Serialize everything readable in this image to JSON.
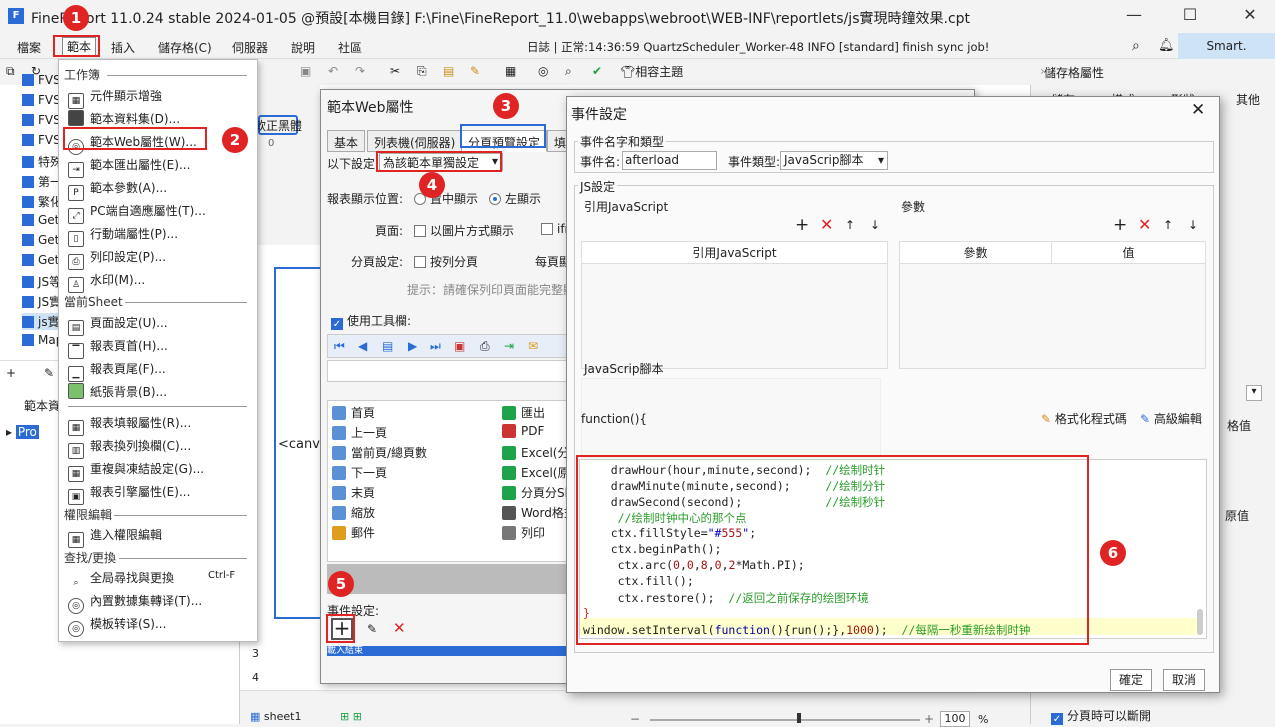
{
  "window": {
    "title": "FineReport 11.0.24 stable 2024-01-05 @預設[本機目錄]    F:\\Fine\\FineReport_11.0\\webapps\\webroot\\WEB-INF\\reportlets/js實現時鐘效果.cpt",
    "minimize": "—",
    "maximize": "☐",
    "close": "✕"
  },
  "menubar": {
    "items": [
      "檔案",
      "範本",
      "插入",
      "儲存格(C)",
      "伺服器",
      "說明",
      "社區"
    ],
    "log": "日誌 | 正常:14:36:59 QuartzScheduler_Worker-48 INFO [standard] finish sync job!",
    "user": "Smart."
  },
  "toolbar": {
    "compat_theme": "相容主題"
  },
  "leftpanel": {
    "tree": [
      "FVS",
      "FVS",
      "FVS",
      "FVS",
      "特殊",
      "第一",
      "繁化",
      "Get",
      "Get",
      "Get",
      "JS等",
      "JS實",
      "js實",
      "Map"
    ],
    "template_label": "範本資",
    "project": "Pro"
  },
  "dropdown": {
    "sections": {
      "workbook": "工作簿",
      "current_sheet": "當前Sheet",
      "permission": "權限編輯",
      "find": "查找/更換"
    },
    "workbook_items": [
      "元件顯示增強",
      "範本資料集(D)...",
      "範本Web屬性(W)...",
      "範本匯出屬性(E)...",
      "範本參數(A)...",
      "PC端自適應屬性(T)...",
      "行動端屬性(P)...",
      "列印設定(P)...",
      "水印(M)..."
    ],
    "sheet_items": [
      "頁面設定(U)...",
      "報表頁首(H)...",
      "報表頁尾(F)...",
      "紙張背景(B)...",
      "報表填報屬性(R)...",
      "報表換列換欄(C)...",
      "重複與凍結設定(G)...",
      "報表引擎屬性(E)..."
    ],
    "permission_items": [
      "進入權限編輯"
    ],
    "find_items": [
      "全局尋找與更換",
      "內置數據集轉译(T)...",
      "模板转译(S)..."
    ],
    "find_shortcut": "Ctrl-F"
  },
  "sheet": {
    "font_label": "軟正黑體",
    "canvas_text": "<canv",
    "row3": "3",
    "row4": "4",
    "sheet_tab": "sheet1",
    "zoom": "100",
    "zoom_unit": "%"
  },
  "webdlg": {
    "title": "範本Web屬性",
    "tabs": [
      "基本",
      "列表機(伺服器)",
      "分頁預覽設定",
      "填"
    ],
    "setting_label": "以下設定",
    "setting_value": "為該範本單獨設定",
    "display_pos_label": "報表顯示位置:",
    "center": "置中顯示",
    "left": "左顯示",
    "page_label": "頁面:",
    "image_mode": "以圖片方式顯示",
    "ifr": "ifr",
    "paging_label": "分頁設定:",
    "by_column": "按列分頁",
    "per_page": "每頁顯",
    "hint": "提示：請確保列印頁面能完整顯",
    "use_toolbar": "使用工具欄:",
    "buttons_left": [
      "首頁",
      "上一頁",
      "當前頁/總頁數",
      "下一頁",
      "末頁",
      "縮放",
      "郵件"
    ],
    "buttons_right": [
      "匯出",
      "PDF",
      "Excel(分頁",
      "Excel(原樣",
      "分頁分Sh",
      "Word格式",
      "列印"
    ],
    "event_label": "事件設定:",
    "event_row": "載入結束"
  },
  "evtdlg": {
    "title": "事件設定",
    "name_type_group": "事件名字和類型",
    "name_label": "事件名:",
    "name_value": "afterload",
    "type_label": "事件類型:",
    "type_value": "JavaScrip腳本",
    "js_group": "JS設定",
    "ref_js_label": "引用JavaScript",
    "params_label": "參數",
    "ref_js_col": "引用JavaScript",
    "param_col": "參數",
    "value_col": "值",
    "script_label": "JavaScrip腳本",
    "func_header": "function(){",
    "format_code": "格式化程式碼",
    "advanced": "高級編輯",
    "ok": "確定",
    "cancel": "取消"
  },
  "code_lines": [
    "    drawHour(hour,minute,second);  //绘制时针",
    "    drawMinute(minute,second);     //绘制分针",
    "    drawSecond(second);            //绘制秒针",
    "     //绘制时钟中心的那个点",
    "    ctx.fillStyle=\"#555\";",
    "    ctx.beginPath();",
    "     ctx.arc(0,0,8,0,2*Math.PI);",
    "     ctx.fill();",
    "     ctx.restore();  //返回之前保存的绘图环境",
    "}",
    "window.setInterval(function(){run();},1000);  //每隔一秒重新绘制时钟",
    "}"
  ],
  "right_panel": {
    "title": "儲存格屬性",
    "tabs": [
      "儲存",
      "樣式",
      "形狀",
      "其他"
    ],
    "value": "格值",
    "original": "原值",
    "page_break": "分頁時可以斷開"
  },
  "badges": [
    "1",
    "2",
    "3",
    "4",
    "5",
    "6"
  ],
  "colors": {
    "accent": "#2b6bd6",
    "badge": "#e02424",
    "highlight": "#ffffcc"
  }
}
